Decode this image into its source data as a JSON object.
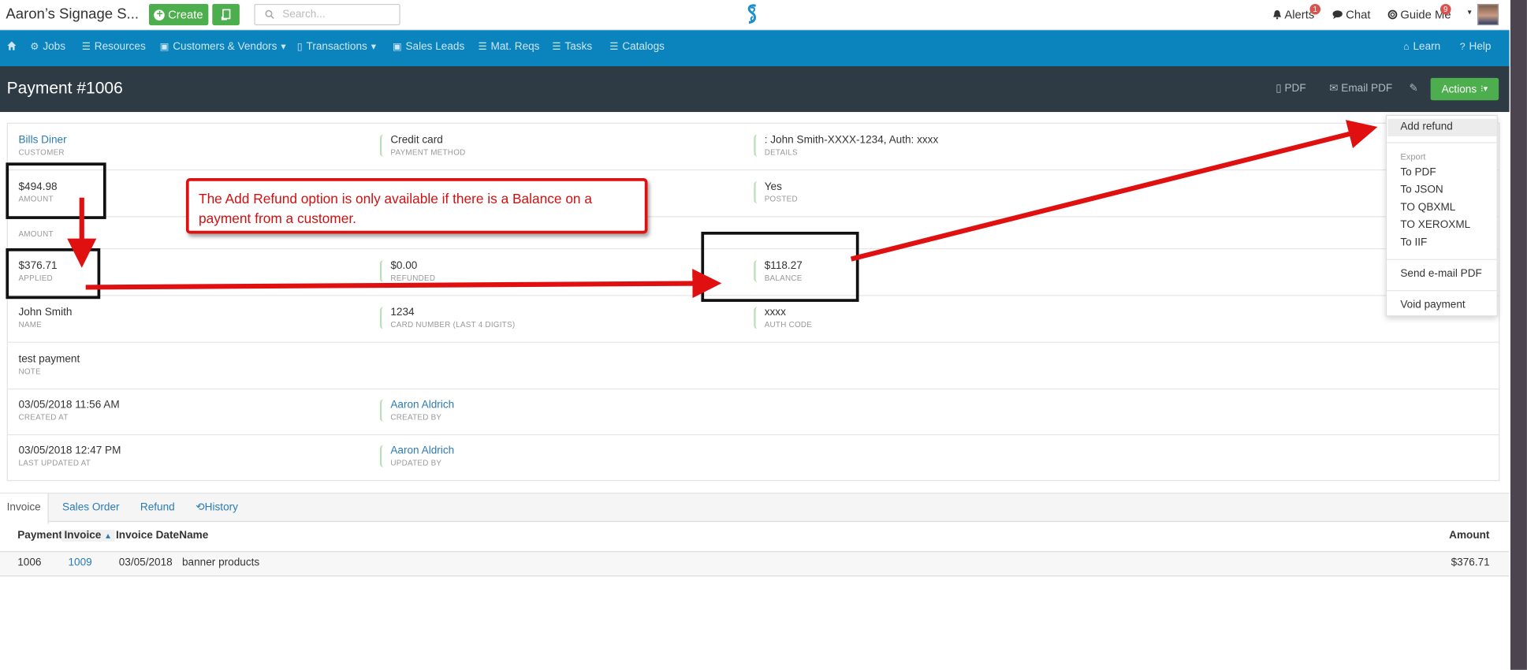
{
  "header": {
    "brand": "Aaron’s Signage S...",
    "create_label": "Create",
    "search_placeholder": "Search...",
    "alerts_label": "Alerts",
    "alerts_count": "1",
    "chat_label": "Chat",
    "guide_label": "Guide Me",
    "guide_count": "9"
  },
  "nav": {
    "items": [
      "Jobs",
      "Resources",
      "Customers & Vendors",
      "Transactions",
      "Sales Leads",
      "Mat. Reqs",
      "Tasks",
      "Catalogs"
    ],
    "learn": "Learn",
    "help": "Help"
  },
  "titlebar": {
    "title": "Payment #1006",
    "pdf": "PDF",
    "email_pdf": "Email PDF",
    "actions": "Actions"
  },
  "details": {
    "customer": {
      "value": "Bills Diner",
      "label": "CUSTOMER"
    },
    "payment_method": {
      "value": "Credit card",
      "label": "PAYMENT METHOD"
    },
    "details": {
      "value": ": John Smith-XXXX-1234, Auth: xxxx",
      "label": "DETAILS"
    },
    "amount": {
      "value": "$494.98",
      "label": "AMOUNT"
    },
    "posted": {
      "value": "Yes",
      "label": "POSTED"
    },
    "amount2": {
      "label": "AMOUNT"
    },
    "applied": {
      "value": "$376.71",
      "label": "APPLIED"
    },
    "refunded": {
      "value": "$0.00",
      "label": "REFUNDED"
    },
    "balance": {
      "value": "$118.27",
      "label": "BALANCE"
    },
    "name": {
      "value": "John Smith",
      "label": "NAME"
    },
    "card_number": {
      "value": "1234",
      "label": "CARD NUMBER (LAST 4 DIGITS)"
    },
    "auth_code": {
      "value": "xxxx",
      "label": "AUTH CODE"
    },
    "note": {
      "value": "test payment",
      "label": "NOTE"
    },
    "created_at": {
      "value": "03/05/2018 11:56 AM",
      "label": "CREATED AT"
    },
    "created_by": {
      "value": "Aaron Aldrich",
      "label": "CREATED BY"
    },
    "updated_at": {
      "value": "03/05/2018 12:47 PM",
      "label": "LAST UPDATED AT"
    },
    "updated_by": {
      "value": "Aaron Aldrich",
      "label": "UPDATED BY"
    }
  },
  "actions_menu": {
    "add_refund": "Add refund",
    "export_header": "Export",
    "to_pdf": "To PDF",
    "to_json": "To JSON",
    "to_qbxml": "TO QBXML",
    "to_xeroxml": "TO XEROXML",
    "to_iif": "To IIF",
    "send_email_pdf": "Send e-mail PDF",
    "void_payment": "Void payment"
  },
  "tabs": [
    "Invoice",
    "Sales Order",
    "Refund",
    "History"
  ],
  "table": {
    "columns": [
      "Payment",
      "Invoice",
      "Invoice Date",
      "Name",
      "Amount"
    ],
    "rows": [
      {
        "payment": "1006",
        "invoice": "1009",
        "invoice_date": "03/05/2018",
        "name": "banner products",
        "amount": "$376.71"
      }
    ]
  },
  "annotation": {
    "callout_text": "The Add Refund option is only available if there is a Balance on a payment from a customer."
  },
  "colors": {
    "nav_blue": "#0b84be",
    "title_dark": "#2e3b45",
    "green": "#4cae4c",
    "link_blue": "#2a7ab5",
    "annotation_red": "#e01010"
  }
}
